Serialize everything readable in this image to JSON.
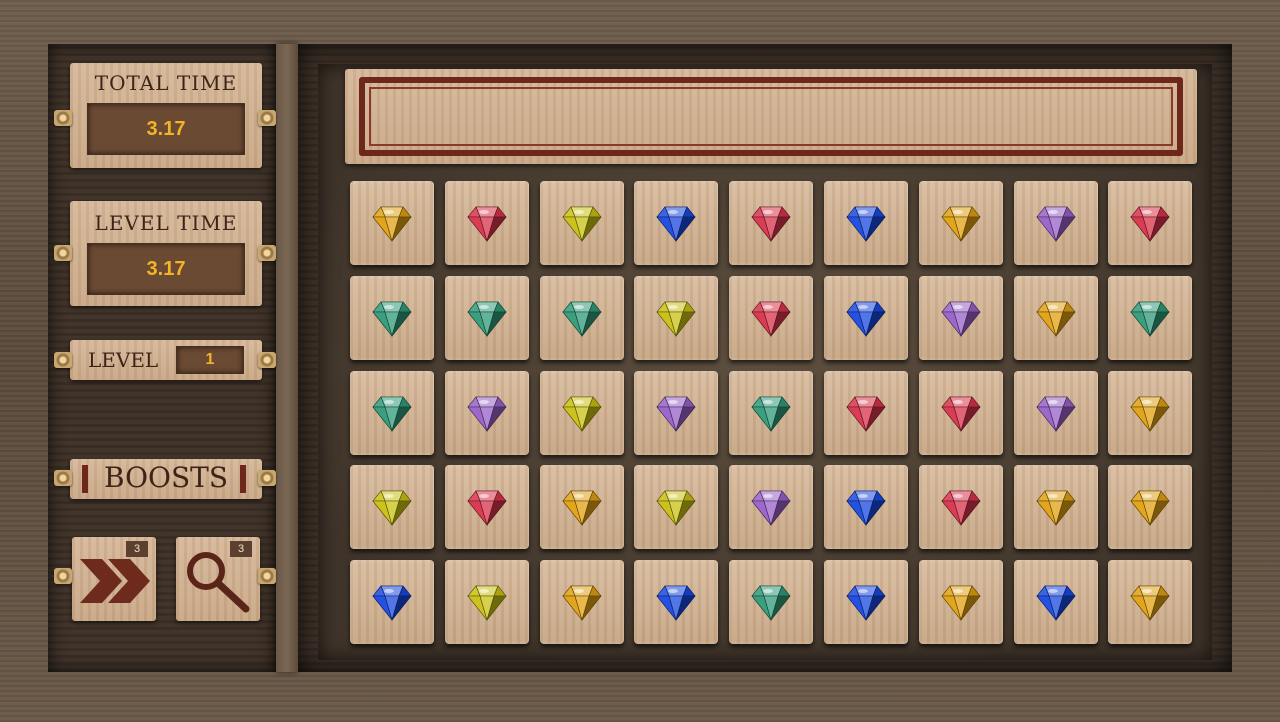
{
  "hud": {
    "total_time": {
      "label": "TOTAL TIME",
      "value": "3.17"
    },
    "level_time": {
      "label": "LEVEL TIME",
      "value": "3.17"
    },
    "level": {
      "label": "LEVEL",
      "value": "1"
    },
    "boosts": {
      "label": "BOOSTS",
      "items": [
        {
          "icon": "double-chevron-icon",
          "count": "3"
        },
        {
          "icon": "magnifier-icon",
          "count": "3"
        }
      ]
    }
  },
  "banner": {
    "text": ""
  },
  "board": {
    "gem_colors": {
      "orange": "#e0a010",
      "red": "#d8324a",
      "yellow": "#c8c010",
      "blue": "#1848e0",
      "purple": "#9860c8",
      "green": "#2f9a78"
    },
    "grid": [
      [
        "orange",
        "red",
        "yellow",
        "blue",
        "red",
        "blue",
        "orange",
        "purple",
        "red"
      ],
      [
        "green",
        "green",
        "green",
        "yellow",
        "red",
        "blue",
        "purple",
        "orange",
        "green"
      ],
      [
        "green",
        "purple",
        "yellow",
        "purple",
        "green",
        "red",
        "red",
        "purple",
        "orange"
      ],
      [
        "yellow",
        "red",
        "orange",
        "yellow",
        "purple",
        "blue",
        "red",
        "orange",
        "orange"
      ],
      [
        "blue",
        "yellow",
        "orange",
        "blue",
        "green",
        "blue",
        "orange",
        "blue",
        "orange"
      ]
    ]
  }
}
